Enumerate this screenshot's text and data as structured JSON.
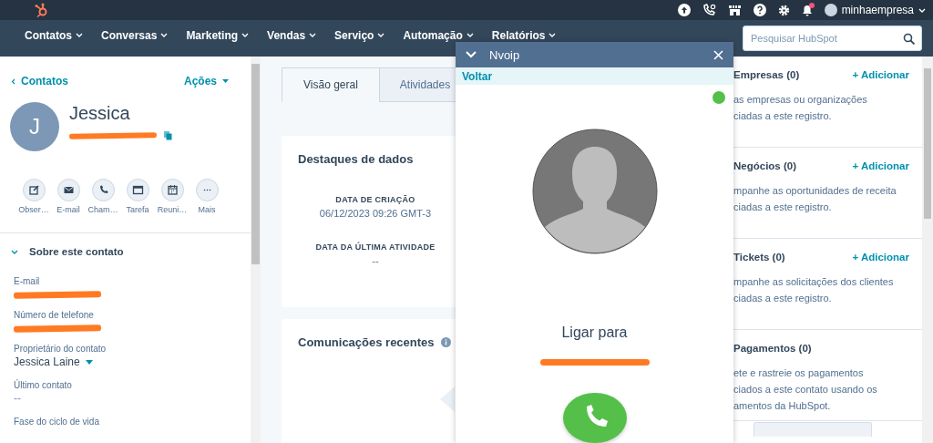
{
  "top_bar": {
    "notifications": {
      "unread": true
    },
    "account": "minhaempresa"
  },
  "nav": {
    "items": [
      {
        "label": "Contatos"
      },
      {
        "label": "Conversas"
      },
      {
        "label": "Marketing"
      },
      {
        "label": "Vendas"
      },
      {
        "label": "Serviço"
      },
      {
        "label": "Automação"
      },
      {
        "label": "Relatórios"
      }
    ],
    "search": {
      "placeholder": "Pesquisar HubSpot"
    }
  },
  "contact": {
    "back_link": "Contatos",
    "actions": "Ações",
    "initial": "J",
    "name": "Jessica",
    "quick_actions": [
      {
        "label": "Obser…",
        "kind": "note"
      },
      {
        "label": "E-mail",
        "kind": "email"
      },
      {
        "label": "Cham…",
        "kind": "call"
      },
      {
        "label": "Tarefa",
        "kind": "task"
      },
      {
        "label": "Reuni…",
        "kind": "meeting"
      },
      {
        "label": "Mais",
        "kind": "more"
      }
    ],
    "section": {
      "title": "Sobre este contato",
      "expanded": true
    },
    "fields": [
      {
        "label": "E-mail",
        "kind": "redacted"
      },
      {
        "label": "Número de telefone",
        "kind": "redacted"
      },
      {
        "label": "Proprietário do contato",
        "kind": "dropdown",
        "value": "Jessica Laine"
      },
      {
        "label": "Último contato",
        "kind": "text",
        "value": "--"
      },
      {
        "label": "Fase do ciclo de vida",
        "kind": "label"
      }
    ]
  },
  "tabs": [
    {
      "label": "Visão geral",
      "selected": true
    },
    {
      "label": "Atividades",
      "selected": false
    }
  ],
  "highlights": {
    "title": "Destaques de dados",
    "items": [
      {
        "label": "DATA DE CRIAÇÃO",
        "value": "06/12/2023 09:26 GMT-3"
      },
      {
        "label": "DATA DA ÚLTIMA ATIVIDADE",
        "value": "--"
      }
    ]
  },
  "communications": {
    "title": "Comunicações recentes"
  },
  "dialer": {
    "title": "Nvoip",
    "back": "Voltar",
    "online": true,
    "prompt": "Ligar para"
  },
  "associations": [
    {
      "title": "Empresas (0)",
      "action": "+ Adicionar",
      "lines": [
        "as empresas ou organizações",
        "ciadas a este registro."
      ]
    },
    {
      "title": "Negócios (0)",
      "action": "+ Adicionar",
      "lines": [
        "mpanhe as oportunidades de receita",
        "ciadas a este registro."
      ]
    },
    {
      "title": "Tickets (0)",
      "action": "+ Adicionar",
      "lines": [
        "mpanhe as solicitações dos clientes",
        "ciadas a este registro."
      ]
    },
    {
      "title": "Pagamentos (0)",
      "lines": [
        "ete e rastreie os pagamentos",
        "ciados a este contato usando os",
        "amentos da HubSpot."
      ],
      "setup_button": true
    }
  ]
}
